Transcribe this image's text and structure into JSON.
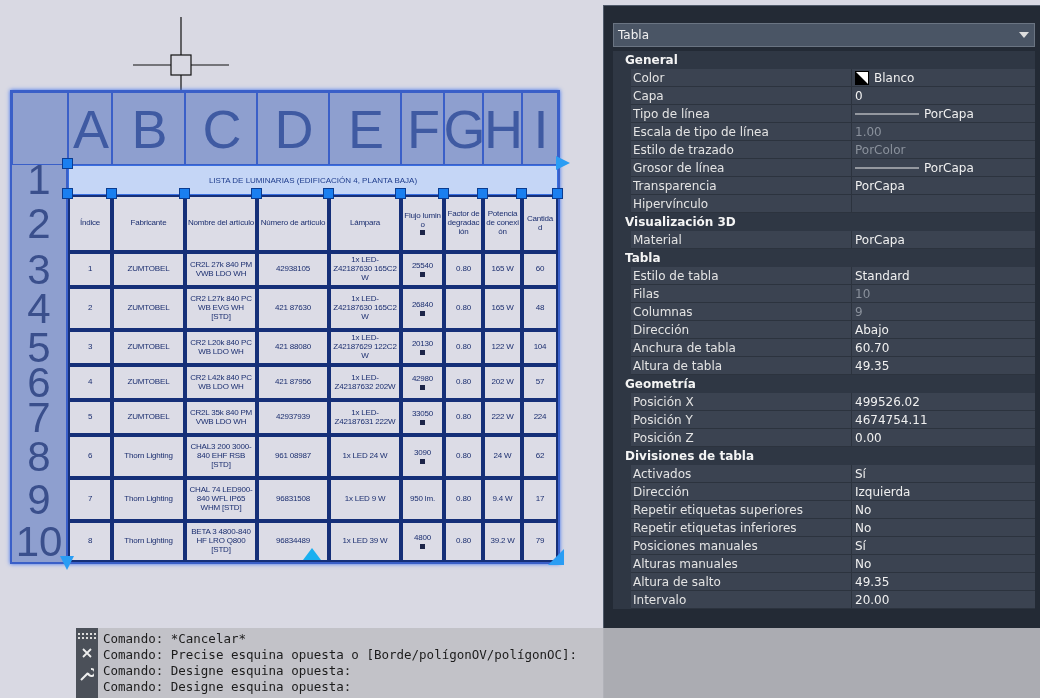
{
  "canvas": {
    "column_letters": [
      "A",
      "B",
      "C",
      "D",
      "E",
      "F",
      "G",
      "H",
      "I"
    ],
    "row_numbers": [
      "1",
      "2",
      "3",
      "4",
      "5",
      "6",
      "7",
      "8",
      "9",
      "10"
    ],
    "table": {
      "title": "LISTA DE LUMINARIAS (EDIFICACIÓN 4, PLANTA BAJA)",
      "header": {
        "cells": [
          "Índice",
          "Fabricante",
          "Nombre del artículo",
          "Número de artículo",
          "Lámpara",
          "Flujo lumino",
          "Factor de degradación",
          "Potencia de conexión",
          "Cantidad"
        ],
        "flux_mark": true
      },
      "rows": [
        {
          "cells": [
            "1",
            "ZUMTOBEL",
            "CR2L 27k 840 PM VWB LDO WH",
            "42938105",
            "1x LED-Z42187630 165C2 W",
            "25540",
            "0.80",
            "165 W",
            "60"
          ],
          "flux_mark": true
        },
        {
          "cells": [
            "2",
            "ZUMTOBEL",
            "CR2 L27k 840 PC WB EVG WH [STD]",
            "421 87630",
            "1x LED-Z42187630 165C2 W",
            "26840",
            "0.80",
            "165 W",
            "48"
          ],
          "flux_mark": true
        },
        {
          "cells": [
            "3",
            "ZUMTOBEL",
            "CR2 L20k 840 PC WB LDO WH",
            "421 88080",
            "1x LED-Z42187629 122C2 W",
            "20130",
            "0.80",
            "122 W",
            "104"
          ],
          "flux_mark": true
        },
        {
          "cells": [
            "4",
            "ZUMTOBEL",
            "CR2 L42k 840 PC WB LDO WH",
            "421 87956",
            "1x LED-Z42187632 202W",
            "42980",
            "0.80",
            "202 W",
            "57"
          ],
          "flux_mark": true
        },
        {
          "cells": [
            "5",
            "ZUMTOBEL",
            "CR2L 35k 840 PM VWB LDO WH",
            "42937939",
            "1x LED-Z42187631 222W",
            "33050",
            "0.80",
            "222 W",
            "224"
          ],
          "flux_mark": true
        },
        {
          "cells": [
            "6",
            "Thorn Lighting",
            "CHAL3 200 3000-840 EHF RSB [STD]",
            "961 08987",
            "1x LED 24 W",
            "3090",
            "0.80",
            "24 W",
            "62"
          ],
          "flux_mark": true
        },
        {
          "cells": [
            "7",
            "Thorn Lighting",
            "CHAL 74 LED900-840 WFL IP65 WHM [STD]",
            "96831508",
            "1x LED 9 W",
            "950 lm.",
            "0.80",
            "9.4 W",
            "17"
          ],
          "flux_mark": false
        },
        {
          "cells": [
            "8",
            "Thorn Lighting",
            "BETA 3 4800-840 HF LRO Q800 [STD]",
            "96834489",
            "1x LED 39 W",
            "4800",
            "0.80",
            "39.2 W",
            "79"
          ],
          "flux_mark": true
        }
      ]
    }
  },
  "properties": {
    "selector": "Tabla",
    "sections": [
      {
        "title": "General",
        "rows": [
          {
            "label": "Color",
            "value": "Blanco",
            "kind": "color",
            "disabled": false
          },
          {
            "label": "Capa",
            "value": "0",
            "kind": "text",
            "disabled": false
          },
          {
            "label": "Tipo de línea",
            "value": "PorCapa",
            "kind": "line",
            "disabled": false
          },
          {
            "label": "Escala de tipo de línea",
            "value": "1.00",
            "kind": "text",
            "disabled": true
          },
          {
            "label": "Estilo de trazado",
            "value": "PorColor",
            "kind": "text",
            "disabled": true
          },
          {
            "label": "Grosor de línea",
            "value": "PorCapa",
            "kind": "line",
            "disabled": false
          },
          {
            "label": "Transparencia",
            "value": "PorCapa",
            "kind": "text",
            "disabled": false
          },
          {
            "label": "Hipervínculo"
          }
        ]
      },
      {
        "title": "Visualización 3D",
        "rows": [
          {
            "label": "Material",
            "value": "PorCapa",
            "kind": "text",
            "disabled": false
          }
        ]
      },
      {
        "title": "Tabla",
        "rows": [
          {
            "label": "Estilo de tabla",
            "value": "Standard",
            "kind": "text",
            "disabled": false
          },
          {
            "label": "Filas",
            "value": "10",
            "kind": "text",
            "disabled": true
          },
          {
            "label": "Columnas",
            "value": "9",
            "kind": "text",
            "disabled": true
          },
          {
            "label": "Dirección",
            "value": "Abajo",
            "kind": "text",
            "disabled": false
          },
          {
            "label": "Anchura de tabla",
            "value": "60.70",
            "kind": "text",
            "disabled": false
          },
          {
            "label": "Altura de tabla",
            "value": "49.35",
            "kind": "text",
            "disabled": false
          }
        ]
      },
      {
        "title": "Geometría",
        "rows": [
          {
            "label": "Posición X",
            "value": "499526.02",
            "kind": "text",
            "disabled": false
          },
          {
            "label": "Posición Y",
            "value": "4674754.11",
            "kind": "text",
            "disabled": false
          },
          {
            "label": "Posición Z",
            "value": "0.00",
            "kind": "text",
            "disabled": false
          }
        ]
      },
      {
        "title": "Divisiones de tabla",
        "rows": [
          {
            "label": "Activados",
            "value": "Sí",
            "kind": "text",
            "disabled": false
          },
          {
            "label": "Dirección",
            "value": "Izquierda",
            "kind": "text",
            "disabled": false
          },
          {
            "label": "Repetir etiquetas superiores",
            "value": "No",
            "kind": "text",
            "disabled": false
          },
          {
            "label": "Repetir etiquetas inferiores",
            "value": "No",
            "kind": "text",
            "disabled": false
          },
          {
            "label": "Posiciones manuales",
            "value": "Sí",
            "kind": "text",
            "disabled": false
          },
          {
            "label": "Alturas manuales",
            "value": "No",
            "kind": "text",
            "disabled": false
          },
          {
            "label": "Altura de salto",
            "value": "49.35",
            "kind": "text",
            "disabled": false
          },
          {
            "label": "Intervalo",
            "value": "20.00",
            "kind": "text",
            "disabled": false
          }
        ]
      }
    ]
  },
  "command_line": {
    "lines": [
      "Comando: *Cancelar*",
      "Comando: Precise esquina opuesta o [Borde/polígonOV/polígonOC]:",
      "Comando: Designe esquina opuesta:",
      "Comando: Designe esquina opuesta:"
    ]
  }
}
